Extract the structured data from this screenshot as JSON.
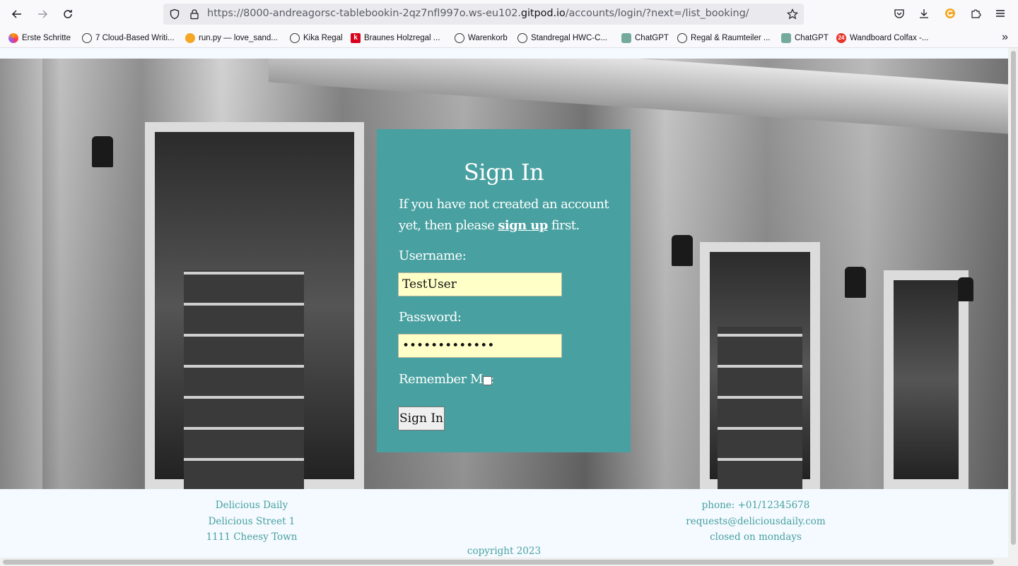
{
  "browser": {
    "url_prefix": "https://8000-andreagorsc-tablebookin-2qz7nfl997o.ws-eu102.",
    "url_domain": "gitpod.io",
    "url_path": "/accounts/login/?next=/list_booking/"
  },
  "bookmarks": [
    {
      "label": "Erste Schritte",
      "icon": "firefox-icon"
    },
    {
      "label": "7 Cloud-Based Writi...",
      "icon": "globe-icon"
    },
    {
      "label": "run.py — love_sand...",
      "icon": "run-icon"
    },
    {
      "label": "Kika Regal",
      "icon": "globe-icon"
    },
    {
      "label": "Braunes Holzregal ...",
      "icon": "k-icon"
    },
    {
      "label": "Warenkorb",
      "icon": "globe-icon"
    },
    {
      "label": "Standregal HWC-C...",
      "icon": "globe-icon"
    },
    {
      "label": "ChatGPT",
      "icon": "chatgpt-icon"
    },
    {
      "label": "Regal & Raumteiler ...",
      "icon": "globe-icon"
    },
    {
      "label": "ChatGPT",
      "icon": "chatgpt-icon"
    },
    {
      "label": "Wandboard Colfax -...",
      "icon": "24-icon"
    }
  ],
  "login": {
    "title": "Sign In",
    "intro_1": "If you have not created an account yet, then please ",
    "signup_link": "sign up",
    "intro_2": " first.",
    "username_label": "Username:",
    "username_value": "TestUser",
    "password_label": "Password:",
    "password_value": "•••••••••••••",
    "remember_label": "Remember Me:",
    "submit_label": "Sign In"
  },
  "footer": {
    "left": [
      "Delicious Daily",
      "Delicious Street 1",
      "1111 Cheesy Town"
    ],
    "right": [
      "phone: +01/12345678",
      "requests@deliciousdaily.com",
      "closed on mondays"
    ],
    "copyright": "copyright 2023"
  },
  "colors": {
    "card": "#48a0a0",
    "input_bg": "#ffffc8",
    "footer_text": "#48a0a0"
  }
}
